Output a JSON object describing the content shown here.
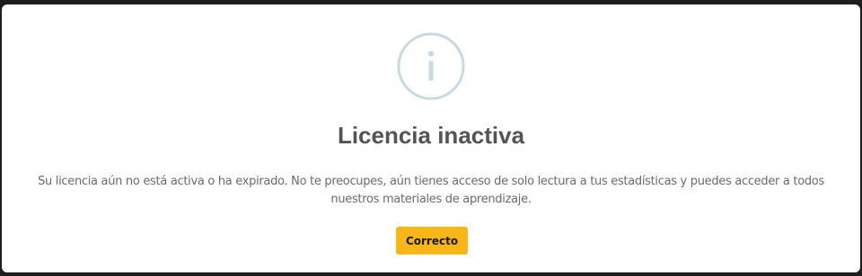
{
  "dialog": {
    "icon": "info-icon",
    "title": "Licencia inactiva",
    "message_line1": "Su licencia aún no está activa o ha expirado. No te preocupes, aún tienes acceso de solo lectura a tus estadísticas y puedes acceder a todos",
    "message_line2": "nuestros materiales de aprendizaje.",
    "confirm_label": "Correcto"
  },
  "colors": {
    "button_bg": "#f8b619",
    "icon_stroke": "#c9dae1",
    "title_text": "#545454",
    "body_text": "#6b6b6b"
  }
}
